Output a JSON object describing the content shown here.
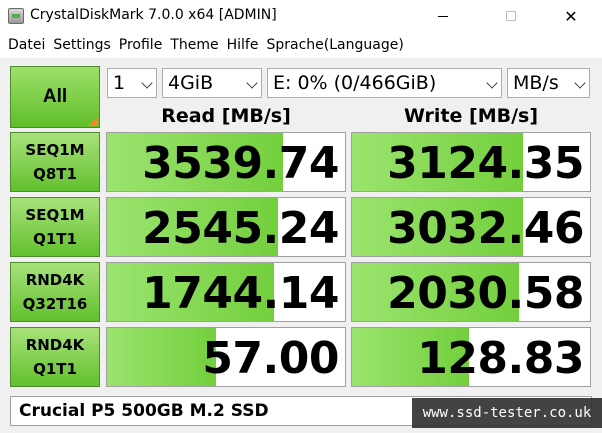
{
  "window": {
    "title": "CrystalDiskMark 7.0.0 x64 [ADMIN]",
    "min_icon": "minimize-icon",
    "max_icon": "maximize-icon",
    "close_icon": "close-icon",
    "close_glyph": "✕"
  },
  "menu": {
    "items": [
      "Datei",
      "Settings",
      "Profile",
      "Theme",
      "Hilfe",
      "Sprache(Language)"
    ]
  },
  "controls": {
    "all_label": "All",
    "count": "1",
    "size": "4GiB",
    "drive": "E: 0% (0/466GiB)",
    "unit": "MB/s"
  },
  "headers": {
    "read": "Read [MB/s]",
    "write": "Write [MB/s]"
  },
  "tests": [
    {
      "line1": "SEQ1M",
      "line2": "Q8T1",
      "read": "3539.74",
      "write": "3124.35",
      "read_fill": 0.74,
      "write_fill": 0.72
    },
    {
      "line1": "SEQ1M",
      "line2": "Q1T1",
      "read": "2545.24",
      "write": "3032.46",
      "read_fill": 0.72,
      "write_fill": 0.72
    },
    {
      "line1": "RND4K",
      "line2": "Q32T16",
      "read": "1744.14",
      "write": "2030.58",
      "read_fill": 0.7,
      "write_fill": 0.7
    },
    {
      "line1": "RND4K",
      "line2": "Q1T1",
      "read": "57.00",
      "write": "128.83",
      "read_fill": 0.46,
      "write_fill": 0.49
    }
  ],
  "comment": "Crucial P5 500GB M.2 SSD",
  "watermark": "www.ssd-tester.co.uk",
  "colors": {
    "accent_green": "#73cf3c",
    "corner_orange": "#f08a24"
  }
}
